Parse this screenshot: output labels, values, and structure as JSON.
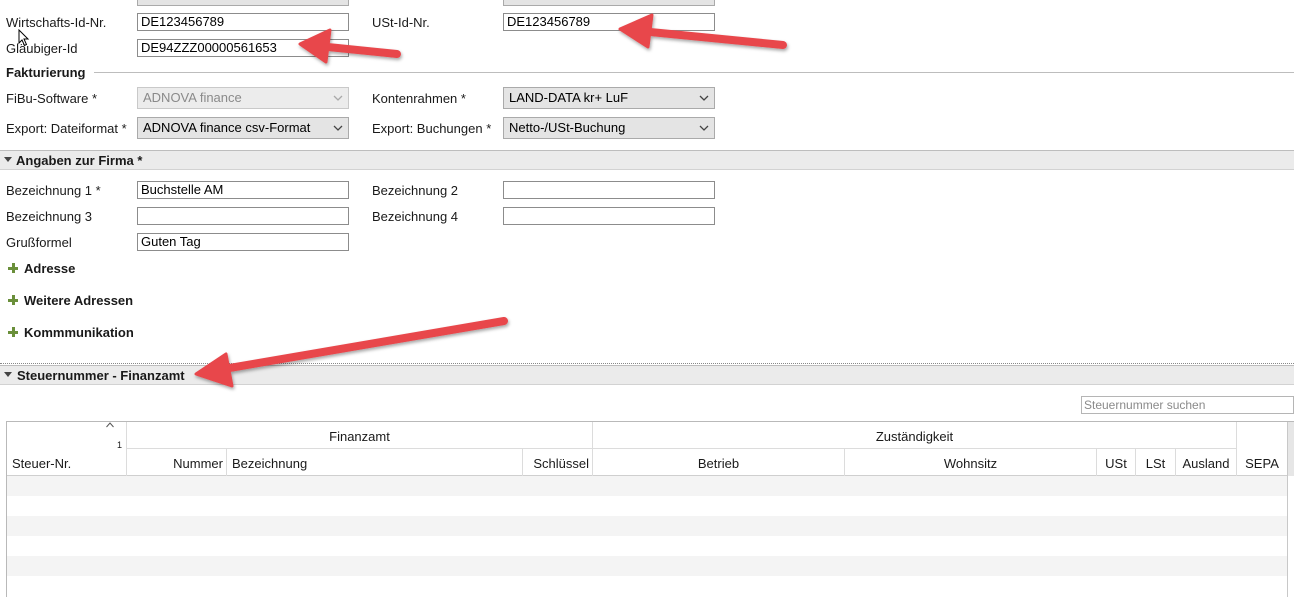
{
  "top_fields": {
    "wirtschafts_label": "Wirtschafts-Id-Nr.",
    "wirtschafts_value": "DE123456789",
    "ust_label": "USt-Id-Nr.",
    "ust_value": "DE123456789",
    "glaeubiger_label": "Gläubiger-Id",
    "glaeubiger_value": "DE94ZZZ00000561653"
  },
  "fakturierung": {
    "title": "Fakturierung",
    "fibu_label": "FiBu-Software *",
    "fibu_value": "ADNOVA finance",
    "kontenrahmen_label": "Kontenrahmen *",
    "kontenrahmen_value": "LAND-DATA kr+ LuF",
    "export_format_label": "Export: Dateiformat *",
    "export_format_value": "ADNOVA finance csv-Format",
    "export_buchungen_label": "Export: Buchungen *",
    "export_buchungen_value": "Netto-/USt-Buchung"
  },
  "firma": {
    "title": "Angaben zur Firma *",
    "bez1_label": "Bezeichnung 1 *",
    "bez1_value": "Buchstelle AM",
    "bez2_label": "Bezeichnung 2",
    "bez2_value": "",
    "bez3_label": "Bezeichnung 3",
    "bez3_value": "",
    "bez4_label": "Bezeichnung 4",
    "bez4_value": "",
    "gruss_label": "Grußformel",
    "gruss_value": "Guten Tag",
    "adresse": "Adresse",
    "weitere_adressen": "Weitere Adressen",
    "kommunikation": "Kommmunikation"
  },
  "steuer": {
    "title": "Steuernummer - Finanzamt",
    "search_placeholder": "Steuernummer suchen",
    "sort_index": "1",
    "group_finanzamt": "Finanzamt",
    "group_zustaendigkeit": "Zuständigkeit",
    "columns": [
      "Steuer-Nr.",
      "Nummer",
      "Bezeichnung",
      "Schlüssel",
      "Betrieb",
      "Wohnsitz",
      "USt",
      "LSt",
      "Ausland",
      "SEPA"
    ]
  },
  "colors": {
    "arrow": "#e8474c",
    "section_bg": "#ebebeb",
    "plus_icon": "#6a8f3a"
  }
}
